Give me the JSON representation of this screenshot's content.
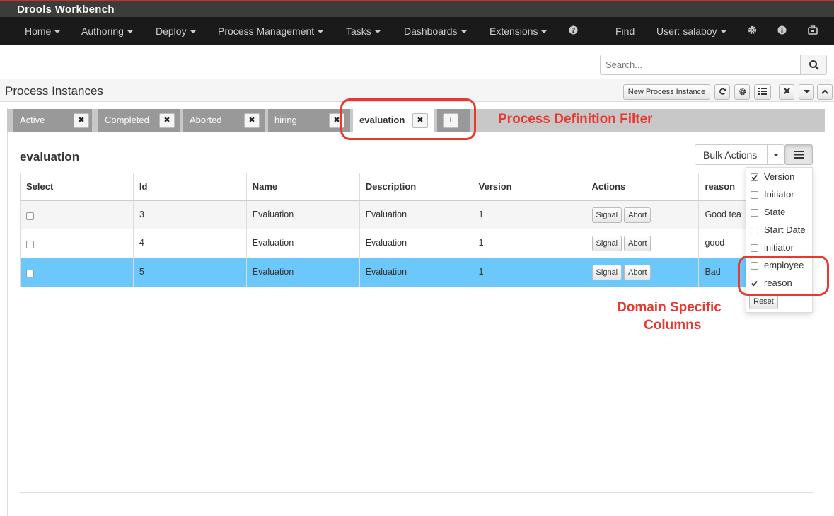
{
  "app": {
    "title": "Drools Workbench"
  },
  "nav": {
    "items": [
      {
        "label": "Home"
      },
      {
        "label": "Authoring"
      },
      {
        "label": "Deploy"
      },
      {
        "label": "Process Management"
      },
      {
        "label": "Tasks"
      },
      {
        "label": "Dashboards"
      },
      {
        "label": "Extensions"
      }
    ],
    "find_label": "Find",
    "user_label": "User: salaboy"
  },
  "search": {
    "placeholder": "Search..."
  },
  "panel": {
    "title": "Process Instances",
    "new_instance_label": "New Process Instance"
  },
  "tabs": [
    {
      "label": "Active"
    },
    {
      "label": "Completed"
    },
    {
      "label": "Aborted"
    },
    {
      "label": "hiring"
    },
    {
      "label": "evaluation"
    }
  ],
  "add_tab_label": "+",
  "annotations": {
    "filter": "Process Definition Filter",
    "columns_line1": "Domain Specific",
    "columns_line2": "Columns"
  },
  "section": {
    "title": "evaluation"
  },
  "bulk": {
    "label": "Bulk Actions"
  },
  "grid": {
    "columns": [
      "Select",
      "Id",
      "Name",
      "Description",
      "Version",
      "Actions",
      "reason"
    ],
    "rows": [
      {
        "id": "3",
        "name": "Evaluation",
        "description": "Evaluation",
        "version": "1",
        "reason": "Good tea",
        "selected": false
      },
      {
        "id": "4",
        "name": "Evaluation",
        "description": "Evaluation",
        "version": "1",
        "reason": "good",
        "selected": false
      },
      {
        "id": "5",
        "name": "Evaluation",
        "description": "Evaluation",
        "version": "1",
        "reason": "Bad",
        "selected": true
      }
    ],
    "signal_label": "Signal",
    "abort_label": "Abort"
  },
  "column_menu": {
    "items": [
      {
        "label": "Version",
        "checked": true
      },
      {
        "label": "Initiator",
        "checked": false
      },
      {
        "label": "State",
        "checked": false
      },
      {
        "label": "Start Date",
        "checked": false
      },
      {
        "label": "initiator",
        "checked": false
      },
      {
        "label": "employee",
        "checked": false
      },
      {
        "label": "reason",
        "checked": true
      }
    ],
    "reset_label": "Reset"
  },
  "colors": {
    "accent_red": "#e8382f",
    "selected_row": "#6cc8fb",
    "navbar": "#1a1a1a"
  }
}
